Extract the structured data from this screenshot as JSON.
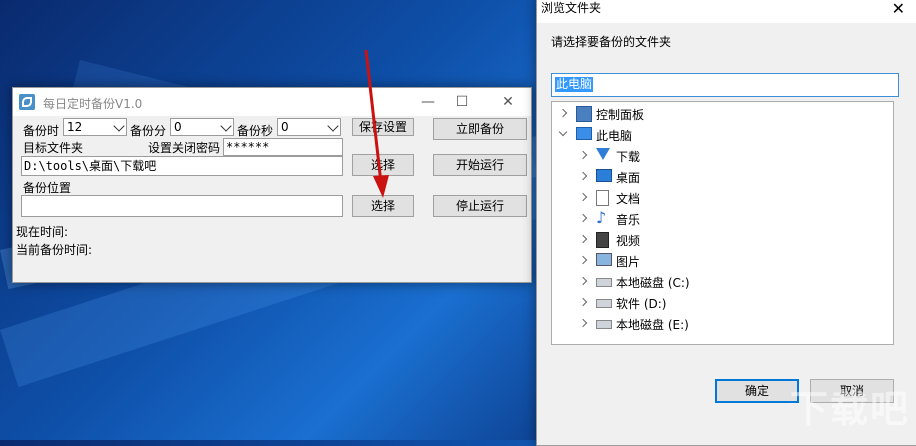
{
  "app": {
    "title": "每日定时备份V1.0",
    "hour_label": "备份时",
    "hour_value": "12",
    "minute_label": "备份分",
    "minute_value": "0",
    "second_label": "备份秒",
    "second_value": "0",
    "save_settings": "保存设置",
    "backup_now": "立即备份",
    "target_folder_label": "目标文件夹",
    "close_password_label": "设置关闭密码",
    "password_value": "******",
    "target_path": "D:\\tools\\桌面\\下载吧",
    "choose1": "选择",
    "start_run": "开始运行",
    "backup_location_label": "备份位置",
    "backup_location_value": "",
    "choose2": "选择",
    "stop_run": "停止运行",
    "current_time_label": "现在时间:",
    "current_backup_time_label": "当前备份时间:"
  },
  "dialog": {
    "title": "浏览文件夹",
    "close": "✕",
    "prompt": "请选择要备份的文件夹",
    "selected": "此电脑",
    "tree": [
      {
        "label": "控制面板",
        "icon": "control-panel-icon",
        "level": 0,
        "expanded": false
      },
      {
        "label": "此电脑",
        "icon": "computer-icon",
        "level": 0,
        "expanded": true
      },
      {
        "label": "下载",
        "icon": "download-icon",
        "level": 1,
        "expanded": false
      },
      {
        "label": "桌面",
        "icon": "desktop-icon",
        "level": 1,
        "expanded": false
      },
      {
        "label": "文档",
        "icon": "document-icon",
        "level": 1,
        "expanded": false
      },
      {
        "label": "音乐",
        "icon": "music-icon",
        "level": 1,
        "expanded": false
      },
      {
        "label": "视频",
        "icon": "video-icon",
        "level": 1,
        "expanded": false
      },
      {
        "label": "图片",
        "icon": "picture-icon",
        "level": 1,
        "expanded": false
      },
      {
        "label": "本地磁盘 (C:)",
        "icon": "drive-c-icon",
        "level": 1,
        "expanded": false
      },
      {
        "label": "软件 (D:)",
        "icon": "drive-icon",
        "level": 1,
        "expanded": false
      },
      {
        "label": "本地磁盘 (E:)",
        "icon": "drive-icon",
        "level": 1,
        "expanded": false
      }
    ],
    "ok": "确定",
    "cancel": "取消"
  },
  "colors": {
    "accent": "#0078d7",
    "arrow": "#cc1111",
    "selection": "#3399ff"
  }
}
